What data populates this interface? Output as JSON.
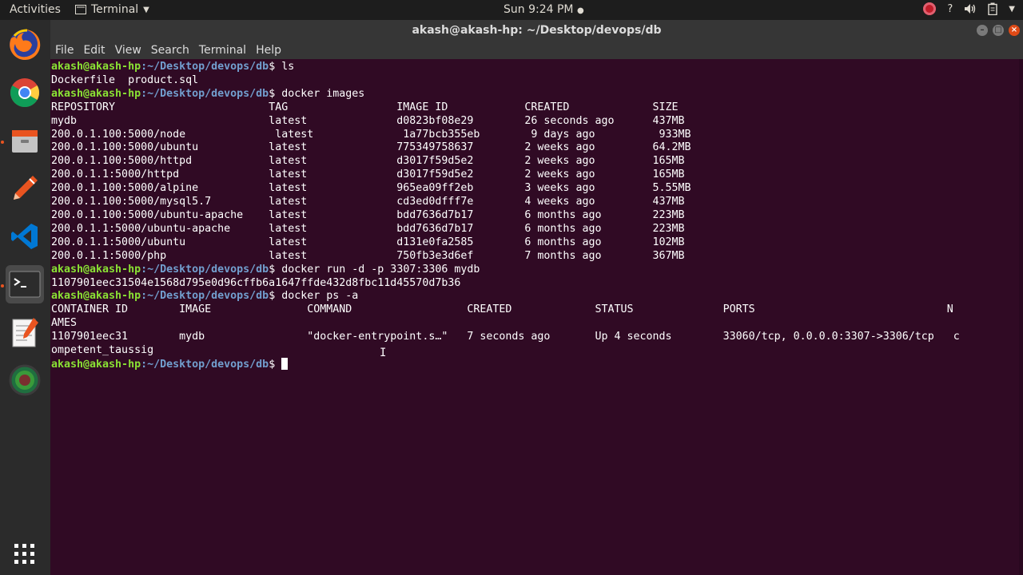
{
  "top_bar": {
    "activities": "Activities",
    "app_name": "Terminal",
    "clock": "Sun  9:24 PM",
    "tray_icons": [
      "recorder-icon",
      "help-icon",
      "volume-icon",
      "battery-icon",
      "power-menu-icon"
    ]
  },
  "window": {
    "title": "akash@akash-hp: ~/Desktop/devops/db",
    "menu": [
      "File",
      "Edit",
      "View",
      "Search",
      "Terminal",
      "Help"
    ]
  },
  "dock": {
    "apps": [
      "firefox-icon",
      "chrome-icon",
      "files-icon",
      "inkscape-icon",
      "vscode-icon",
      "terminal-icon",
      "text-editor-icon",
      "globe-app-icon"
    ],
    "show_apps": "show-apps-icon"
  },
  "prompt": {
    "user": "akash@akash-hp",
    "path": ":~/Desktop/devops/db",
    "symbol": "$"
  },
  "terminal": {
    "cmd1": "ls",
    "ls_output": "Dockerfile  product.sql",
    "cmd2": "docker images",
    "images_header": "REPOSITORY                        TAG                 IMAGE ID            CREATED             SIZE",
    "images_rows": [
      "mydb                              latest              d0823bf08e29        26 seconds ago      437MB",
      "200.0.1.100:5000/node              latest              1a77bcb355eb        9 days ago          933MB",
      "200.0.1.100:5000/ubuntu           latest              775349758637        2 weeks ago         64.2MB",
      "200.0.1.100:5000/httpd            latest              d3017f59d5e2        2 weeks ago         165MB",
      "200.0.1.1:5000/httpd              latest              d3017f59d5e2        2 weeks ago         165MB",
      "200.0.1.100:5000/alpine           latest              965ea09ff2eb        3 weeks ago         5.55MB",
      "200.0.1.100:5000/mysql5.7         latest              cd3ed0dfff7e        4 weeks ago         437MB",
      "200.0.1.100:5000/ubuntu-apache    latest              bdd7636d7b17        6 months ago        223MB",
      "200.0.1.1:5000/ubuntu-apache      latest              bdd7636d7b17        6 months ago        223MB",
      "200.0.1.1:5000/ubuntu             latest              d131e0fa2585        6 months ago        102MB",
      "200.0.1.1:5000/php                latest              750fb3e3d6ef        7 months ago        367MB"
    ],
    "cmd3": "docker run -d -p 3307:3306 mydb",
    "run_output": "1107901eec31504e1568d795e0d96cffb6a1647ffde432d8fbc11d45570d7b36",
    "cmd4": "docker ps -a",
    "ps_header": "CONTAINER ID        IMAGE               COMMAND                  CREATED             STATUS              PORTS                              N",
    "ps_header_wrap": "AMES",
    "ps_row": "1107901eec31        mydb                \"docker-entrypoint.s…\"   7 seconds ago       Up 4 seconds        33060/tcp, 0.0.0.0:3307->3306/tcp   c",
    "ps_row_wrap": "ompetent_taussig"
  },
  "colors": {
    "terminal_bg": "#300a24",
    "prompt_user": "#8ae234",
    "prompt_path": "#729fcf",
    "accent": "#e95420"
  }
}
